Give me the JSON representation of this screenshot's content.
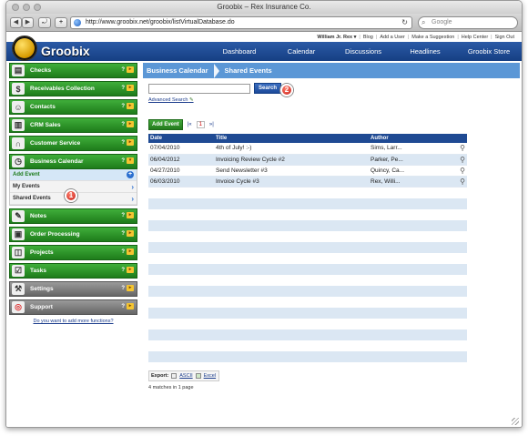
{
  "window": {
    "title": "Groobix – Rex Insurance Co."
  },
  "browser": {
    "url": "http://www.groobix.net/groobix/listVirtualDatabase.do",
    "search_placeholder": "Google"
  },
  "topbar": {
    "user": "William Jr. Rex",
    "user_menu": "▾",
    "links": [
      "Blog",
      "Add a User",
      "Make a Suggestion",
      "Help Center",
      "Sign Out"
    ]
  },
  "header": {
    "logo": "Groobix",
    "nav": [
      "Dashboard",
      "Calendar",
      "Discussions",
      "Headlines",
      "Groobix Store"
    ]
  },
  "sidebar": {
    "items": [
      {
        "label": "Checks",
        "icon": "checkbook-icon"
      },
      {
        "label": "Receivables Collection",
        "icon": "money-icon"
      },
      {
        "label": "Contacts",
        "icon": "contact-icon"
      },
      {
        "label": "CRM Sales",
        "icon": "chart-icon"
      },
      {
        "label": "Customer Service",
        "icon": "headset-icon"
      },
      {
        "label": "Business Calendar",
        "icon": "clock-icon"
      }
    ],
    "submenu": [
      {
        "label": "Add Event",
        "kind": "add"
      },
      {
        "label": "My Events",
        "kind": "arrow"
      },
      {
        "label": "Shared Events",
        "kind": "arrow"
      }
    ],
    "items_after": [
      {
        "label": "Notes",
        "icon": "notes-icon"
      },
      {
        "label": "Order Processing",
        "icon": "box-icon"
      },
      {
        "label": "Projects",
        "icon": "projects-icon"
      },
      {
        "label": "Tasks",
        "icon": "tasks-icon"
      }
    ],
    "gray_items": [
      {
        "label": "Settings",
        "icon": "tools-icon"
      },
      {
        "label": "Support",
        "icon": "lifebuoy-icon"
      }
    ],
    "help_mark": "?",
    "more_link": "Do you want to add more functions?"
  },
  "main": {
    "breadcrumb": [
      "Business Calendar",
      "Shared Events"
    ],
    "search_button": "Search",
    "advanced_search": "Advanced Search",
    "add_event": "Add Event",
    "pager": {
      "first": "|«",
      "current": "1",
      "last": "»|"
    },
    "columns": [
      "Date",
      "Title",
      "Author"
    ],
    "rows": [
      {
        "date": "07/04/2010",
        "title": "4th of July! :-)",
        "author": "Sims, Larr..."
      },
      {
        "date": "06/04/2012",
        "title": "Invoicing Review Cycle #2",
        "author": "Parker, Pe..."
      },
      {
        "date": "04/27/2010",
        "title": "Send Newsletter #3",
        "author": "Quincy, Ca..."
      },
      {
        "date": "06/03/2010",
        "title": "Invoice Cycle #3",
        "author": "Rex, Willi..."
      }
    ],
    "export_label": "Export:",
    "export_ascii": "ASCII",
    "export_excel": "Excel",
    "matches": "4 matches in 1 page"
  },
  "callouts": [
    "1",
    "2"
  ]
}
